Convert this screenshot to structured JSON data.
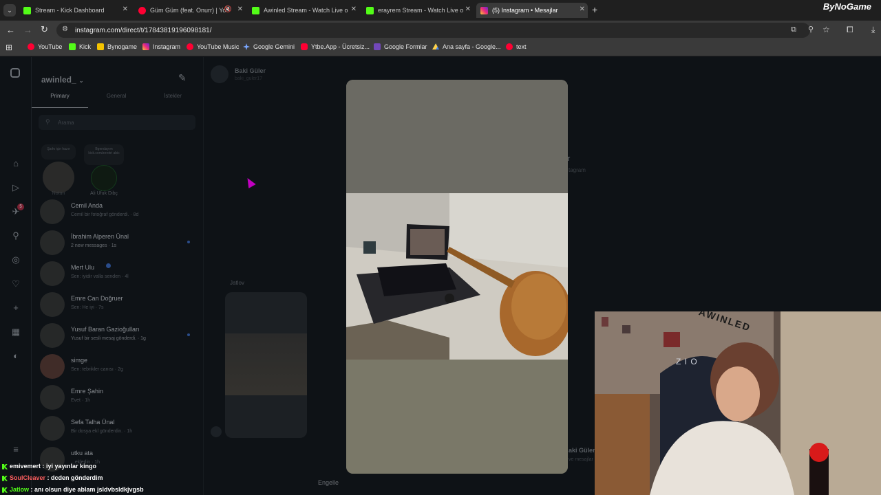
{
  "browser": {
    "tabs": [
      {
        "title": "Stream - Kick Dashboard",
        "icon": "kick-icon"
      },
      {
        "title": "Güm Güm (feat. Onurr) | Yo",
        "icon": "youtube-music-icon",
        "muted": true
      },
      {
        "title": "Awinled Stream - Watch Live o",
        "icon": "kick-icon"
      },
      {
        "title": "erayrem Stream - Watch Live o",
        "icon": "kick-icon"
      },
      {
        "title": "(5) Instagram • Mesajlar",
        "icon": "instagram-icon",
        "active": true
      }
    ],
    "new_tab_label": "+",
    "url": "instagram.com/direct/t/17843819196098181/",
    "bookmarks": [
      "YouTube",
      "Kick",
      "Bynogame",
      "Instagram",
      "YouTube Music",
      "Google Gemini",
      "Ytbe.App - Ücretsiz...",
      "Google Formlar",
      "Ana sayfa - Google...",
      "text"
    ],
    "overlay_logo": "ByNoGame"
  },
  "instagram": {
    "username": "awinled_",
    "tabs": [
      "Primary",
      "General",
      "İstekler"
    ],
    "search_placeholder": "Arama",
    "notes": [
      {
        "note": "Şarkı için hazır",
        "name": "Notun"
      },
      {
        "note": "Bgendayım kick.com/zerotri abic",
        "name": "Ali Ufuk Dibç"
      }
    ],
    "notification_badge": "5",
    "conversations": [
      {
        "name": "Cemil Anda",
        "preview": "Cemil bir fotoğraf gönderdi. · 8d",
        "unread": false
      },
      {
        "name": "İbrahim Alperen Ünal",
        "preview": "2 new messages · 1s",
        "unread": true
      },
      {
        "name": "Mert Ulu",
        "preview": "Sen: iyidir valla senden · 4l",
        "unread": false
      },
      {
        "name": "Emre Can Doğruer",
        "preview": "Sen: He iyi · 7s",
        "unread": false
      },
      {
        "name": "Yusuf Baran Gazioğulları",
        "preview": "Yusuf bir sesli mesaj gönderdi. · 1g",
        "unread": true
      },
      {
        "name": "simge",
        "preview": "Sen: tebrikler canısı · 2g",
        "unread": false
      },
      {
        "name": "Emre Şahin",
        "preview": "Evet · 1h",
        "unread": false
      },
      {
        "name": "Sefa Talha Ünal",
        "preview": "Bir dosya ekl gönderdin. · 1h",
        "unread": false
      },
      {
        "name": "utku ata",
        "preview": "...ekledin · 1h",
        "unread": false
      }
    ],
    "thread": {
      "name": "Baki Güler",
      "handle": "baki_guler17",
      "side_name": "r",
      "side_caption": "tagram",
      "sender_label": "Jatlov",
      "bottom_name": "aki Güler",
      "bottom_caption": "ve mesajlar",
      "block_label": "Engelle"
    }
  },
  "chat": [
    {
      "user": "emivemert",
      "color": "#ffffff",
      "message": "iyi yayınlar kingo"
    },
    {
      "user": "SoulCleaver",
      "color": "#ff5f5f",
      "message": "dcden gönderdim"
    },
    {
      "user": "Jatlow",
      "color": "#53fc18",
      "message": "anı olsun diye ablam jsldvbsldkjvgsb"
    }
  ],
  "webcam": {
    "text": "AWINLED",
    "chair_logo": "Z I O"
  }
}
